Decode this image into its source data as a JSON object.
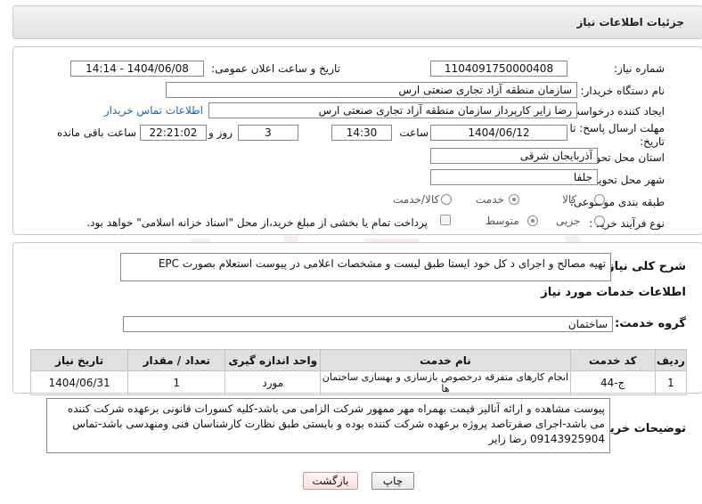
{
  "header": {
    "title": "جزئیات اطلاعات نیاز"
  },
  "form": {
    "need_number": {
      "label": "شماره نیاز:",
      "value": "1104091750000408"
    },
    "announce_date": {
      "label": "تاریخ و ساعت اعلان عمومی:",
      "value": "1404/06/08 - 14:14"
    },
    "buyer_org": {
      "label": "نام دستگاه خریدار:",
      "value": "سازمان منطقه آزاد تجاری صنعتی ارس"
    },
    "requester": {
      "label": "ایجاد کننده درخواست:",
      "value": "رضا زایر کارپرداز سازمان منطقه آزاد تجاری صنعتی ارس",
      "contact_link": "اطلاعات تماس خریدار"
    },
    "deadline": {
      "label_line1": "مهلت ارسال پاسخ: تا",
      "label_line2": "تاریخ:",
      "date": "1404/06/12",
      "time_label": "ساعت",
      "time": "14:30",
      "days": "3",
      "days_label": "روز و",
      "remaining": "22:21:02",
      "remaining_label": "ساعت باقی مانده"
    },
    "province": {
      "label": "استان محل تحویل:",
      "value": "آذربایجان شرقی"
    },
    "city": {
      "label": "شهر محل تحویل:",
      "value": "جلفا"
    },
    "category": {
      "label": "طبقه بندی موضوعی:",
      "options": [
        "کالا",
        "خدمت",
        "کالا/خدمت"
      ],
      "selected": "خدمت"
    },
    "process": {
      "label": "نوع فرآیند خرید :",
      "options": [
        "جزیی",
        "متوسط"
      ],
      "selected": "متوسط",
      "payment_note": "پرداخت تمام یا بخشی از مبلغ خرید،از محل \"اسناد خزانه اسلامی\" خواهد بود."
    }
  },
  "summary": {
    "label": "شرح کلی نیاز:",
    "value": "تهیه مصالح و اجرای د  کل خود ایستا طبق لیست و مشخصات اعلامی در پیوست استعلام بصورت EPC"
  },
  "services": {
    "title": "اطلاعات خدمات مورد نیاز",
    "group_label": "گروه خدمت:",
    "group_value": "ساختمان",
    "columns": [
      "ردیف",
      "کد خدمت",
      "نام خدمت",
      "واحد اندازه گیری",
      "تعداد / مقدار",
      "تاریخ نیاز"
    ],
    "rows": [
      {
        "row": "1",
        "code": "ج-44",
        "name": "انجام کارهای متفرقه درخصوص بازسازی و بهسازی ساختمان ها",
        "unit": "مورد",
        "qty": "1",
        "date": "1404/06/31"
      }
    ]
  },
  "buyer_notes": {
    "label": "توضیحات خریدار:",
    "text": "پیوست مشاهده و ارائه آنالیز قیمت بهمراه مهر ممهور شرکت الزامی می باشد-کلیه کسورات قانونی برعهده شرکت کننده می باشد-اجرای صفرتاصد پروژه برعهده شرکت کننده بوده و بایستی طبق نظارت کارشناسان فنی ومنهدسی باشد-تماس 09143925904 رضا زایر"
  },
  "buttons": {
    "print": "چاپ",
    "back": "بازگشت"
  },
  "watermark": "AriaTender.neT"
}
